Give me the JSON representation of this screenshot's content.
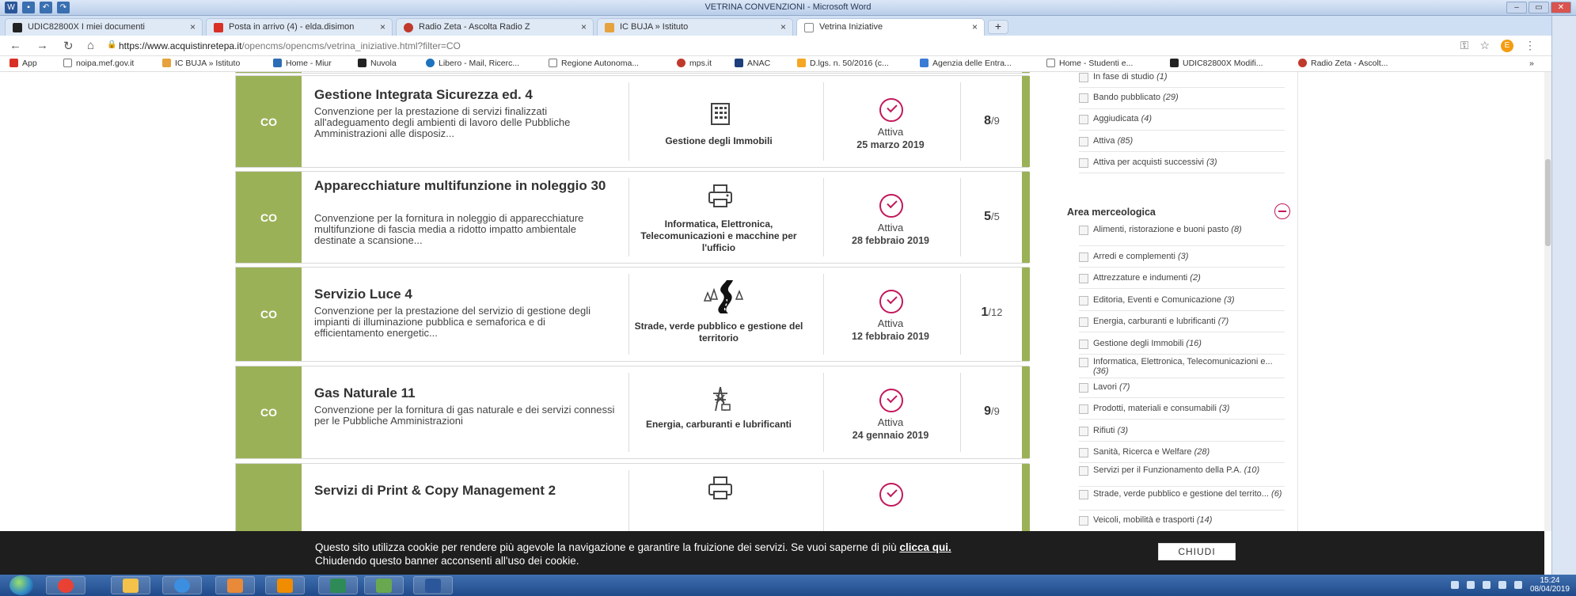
{
  "word": {
    "title": "VETRINA CONVENZIONI - Microsoft Word"
  },
  "tabs": [
    {
      "label": "UDIC82800X I miei documenti",
      "color": "#222222"
    },
    {
      "label": "Posta in arrivo (4) - elda.disimon",
      "color": "#d93025"
    },
    {
      "label": "Radio Zeta - Ascolta Radio Z",
      "color": "#c0392b"
    },
    {
      "label": "IC BUJA » Istituto",
      "color": "#e6a23c"
    },
    {
      "label": "Vetrina Iniziative",
      "color": "#888888"
    }
  ],
  "address": {
    "host": "https://www.acquistinretepa.it",
    "path": "/opencms/opencms/vetrina_iniziative.html?filter=CO",
    "profile": "E"
  },
  "bookmarks": [
    {
      "label": "App",
      "color": "#d93025"
    },
    {
      "label": "noipa.mef.gov.it",
      "color": "#777777"
    },
    {
      "label": "IC BUJA » Istituto",
      "color": "#e6a23c"
    },
    {
      "label": "Home - Miur",
      "color": "#2d6db5"
    },
    {
      "label": "Nuvola",
      "color": "#222222"
    },
    {
      "label": "Libero - Mail, Ricerc...",
      "color": "#1e73be"
    },
    {
      "label": "Regione Autonoma...",
      "color": "#777777"
    },
    {
      "label": "mps.it",
      "color": "#c0392b"
    },
    {
      "label": "ANAC",
      "color": "#1e3f7c"
    },
    {
      "label": "D.lgs. n. 50/2016 (c...",
      "color": "#f5a623"
    },
    {
      "label": "Agenzia delle Entra...",
      "color": "#3a7bd5"
    },
    {
      "label": "Home - Studenti e...",
      "color": "#777777"
    },
    {
      "label": "UDIC82800X Modifi...",
      "color": "#222222"
    },
    {
      "label": "Radio Zeta - Ascolt...",
      "color": "#c0392b"
    }
  ],
  "rows": [
    {
      "type": "CO",
      "title": "Gestione Integrata Sicurezza ed. 4",
      "description": "Convenzione per la prestazione di servizi finalizzati all'adeguamento degli ambienti di lavoro delle Pubbliche Amministrazioni alle disposiz...",
      "category": "Gestione degli Immobili",
      "category_icon": "building-icon",
      "status": "Attiva",
      "date": "25 marzo 2019",
      "lots_active": "8",
      "lots_total": "/9"
    },
    {
      "type": "CO",
      "title": "Apparecchiature multifunzione in noleggio 30",
      "description": "Convenzione per la fornitura in noleggio di apparecchiature multifunzione di fascia media a ridotto impatto ambientale destinate a scansione...",
      "category": "Informatica, Elettronica, Telecomunicazioni e macchine per l'ufficio",
      "category_icon": "printer-icon",
      "status": "Attiva",
      "date": "28 febbraio 2019",
      "lots_active": "5",
      "lots_total": "/5"
    },
    {
      "type": "CO",
      "title": "Servizio Luce 4",
      "description": "Convenzione per la prestazione del servizio di gestione degli impianti di illuminazione pubblica e semaforica e di efficientamento energetic...",
      "category": "Strade, verde pubblico e gestione del territorio",
      "category_icon": "road-icon",
      "status": "Attiva",
      "date": "12 febbraio 2019",
      "lots_active": "1",
      "lots_total": "/12"
    },
    {
      "type": "CO",
      "title": "Gas Naturale 11",
      "description": "Convenzione per la fornitura di gas naturale e dei servizi connessi per le Pubbliche Amministrazioni",
      "category": "Energia, carburanti e lubrificanti",
      "category_icon": "pylon-icon",
      "status": "Attiva",
      "date": "24 gennaio 2019",
      "lots_active": "9",
      "lots_total": "/9"
    },
    {
      "type": "",
      "title": "Servizi di Print & Copy Management 2",
      "description": "",
      "category": "",
      "category_icon": "printer-icon",
      "status": "",
      "date": "",
      "lots_active": "",
      "lots_total": ""
    }
  ],
  "filters": {
    "status_items": [
      {
        "label": "In fase di studio",
        "count": "(1)"
      },
      {
        "label": "Bando pubblicato",
        "count": "(29)"
      },
      {
        "label": "Aggiudicata",
        "count": "(4)"
      },
      {
        "label": "Attiva",
        "count": "(85)"
      },
      {
        "label": "Attiva per acquisti successivi",
        "count": "(3)"
      }
    ],
    "area_title": "Area merceologica",
    "area_items": [
      {
        "label": "Alimenti, ristorazione e buoni pasto",
        "count": "(8)"
      },
      {
        "label": "Arredi e complementi",
        "count": "(3)"
      },
      {
        "label": "Attrezzature e indumenti",
        "count": "(2)"
      },
      {
        "label": "Editoria, Eventi e Comunicazione",
        "count": "(3)"
      },
      {
        "label": "Energia, carburanti e lubrificanti",
        "count": "(7)"
      },
      {
        "label": "Gestione degli Immobili",
        "count": "(16)"
      },
      {
        "label": "Informatica, Elettronica, Telecomunicazioni e...",
        "count": "(36)"
      },
      {
        "label": "Lavori",
        "count": "(7)"
      },
      {
        "label": "Prodotti, materiali e consumabili",
        "count": "(3)"
      },
      {
        "label": "Rifiuti",
        "count": "(3)"
      },
      {
        "label": "Sanità, Ricerca e Welfare",
        "count": "(28)"
      },
      {
        "label": "Servizi per il Funzionamento della P.A.",
        "count": "(10)"
      },
      {
        "label": "Strade, verde pubblico e gestione del territo...",
        "count": "(6)"
      },
      {
        "label": "Veicoli, mobilità e trasporti",
        "count": "(14)"
      }
    ]
  },
  "cookie": {
    "text1": "Questo sito utilizza cookie per rendere più agevole la navigazione e garantire la fruizione dei servizi. Se vuoi saperne di più ",
    "link": "clicca qui.",
    "text2": "Chiudendo questo banner acconsenti all'uso dei cookie.",
    "button": "CHIUDI"
  },
  "taskbar": {
    "time": "15:24",
    "date": "08/04/2019",
    "apps": [
      {
        "name": "chrome-icon",
        "color": "#e94235"
      },
      {
        "name": "explorer-icon",
        "color": "#f3c24b"
      },
      {
        "name": "ie-icon",
        "color": "#3c8ee0"
      },
      {
        "name": "people-icon",
        "color": "#e88a3a"
      },
      {
        "name": "media-player-icon",
        "color": "#f08c00"
      },
      {
        "name": "excel-icon",
        "color": "#2e8b57"
      },
      {
        "name": "sharing-icon",
        "color": "#6aa84f"
      },
      {
        "name": "word-icon",
        "color": "#2b579a"
      }
    ]
  }
}
